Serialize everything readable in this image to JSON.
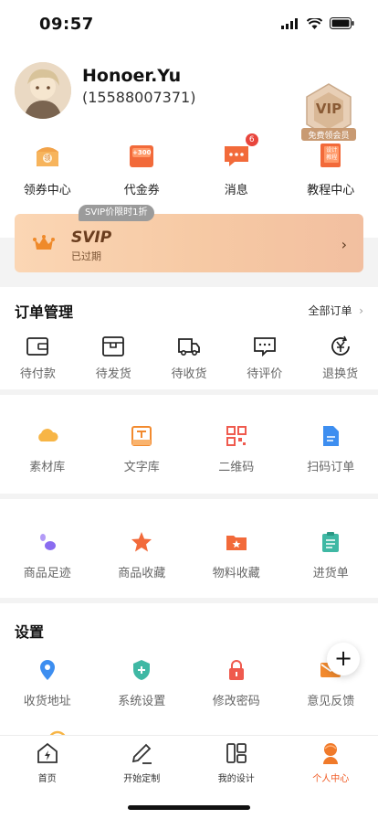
{
  "status_bar": {
    "time": "09:57"
  },
  "profile": {
    "username": "Honoer.Yu",
    "phone": "(15588007371)",
    "vip_badge": {
      "text": "VIP",
      "ribbon": "免费领会员"
    }
  },
  "quick_actions": [
    {
      "label": "领券中心",
      "icon": "coupon-center-icon",
      "icon_text": "领"
    },
    {
      "label": "代金券",
      "icon": "voucher-icon",
      "icon_text": "+300"
    },
    {
      "label": "消息",
      "icon": "message-icon",
      "badge": "6"
    },
    {
      "label": "教程中心",
      "icon": "tutorial-icon",
      "icon_text": "设计教程"
    }
  ],
  "svip_banner": {
    "tag": "SVIP价限时1折",
    "title": "SVIP",
    "status": "已过期"
  },
  "orders": {
    "title": "订单管理",
    "all_link": "全部订单",
    "items": [
      {
        "label": "待付款",
        "icon": "wallet-icon"
      },
      {
        "label": "待发货",
        "icon": "box-icon"
      },
      {
        "label": "待收货",
        "icon": "truck-icon"
      },
      {
        "label": "待评价",
        "icon": "comment-icon"
      },
      {
        "label": "退换货",
        "icon": "refund-icon"
      }
    ]
  },
  "tools": [
    {
      "label": "素材库",
      "icon": "cloud-icon"
    },
    {
      "label": "文字库",
      "icon": "text-icon"
    },
    {
      "label": "二维码",
      "icon": "qrcode-icon"
    },
    {
      "label": "扫码订单",
      "icon": "document-icon"
    }
  ],
  "collections": [
    {
      "label": "商品足迹",
      "icon": "footprint-icon"
    },
    {
      "label": "商品收藏",
      "icon": "star-icon"
    },
    {
      "label": "物料收藏",
      "icon": "folder-star-icon"
    },
    {
      "label": "进货单",
      "icon": "clipboard-icon"
    }
  ],
  "settings": {
    "title": "设置",
    "items": [
      {
        "label": "收货地址",
        "icon": "location-icon"
      },
      {
        "label": "系统设置",
        "icon": "shield-plus-icon"
      },
      {
        "label": "修改密码",
        "icon": "lock-icon"
      },
      {
        "label": "意见反馈",
        "icon": "mail-icon"
      }
    ]
  },
  "fab": {
    "label": "+"
  },
  "tab_bar": [
    {
      "label": "首页",
      "icon": "home-icon",
      "active": false
    },
    {
      "label": "开始定制",
      "icon": "edit-icon",
      "active": false
    },
    {
      "label": "我的设计",
      "icon": "layout-icon",
      "active": false
    },
    {
      "label": "个人中心",
      "icon": "user-icon",
      "active": true
    }
  ],
  "colors": {
    "accent": "#f05a23",
    "badge": "#e8453c",
    "svip_bg": "#f8cfad"
  }
}
